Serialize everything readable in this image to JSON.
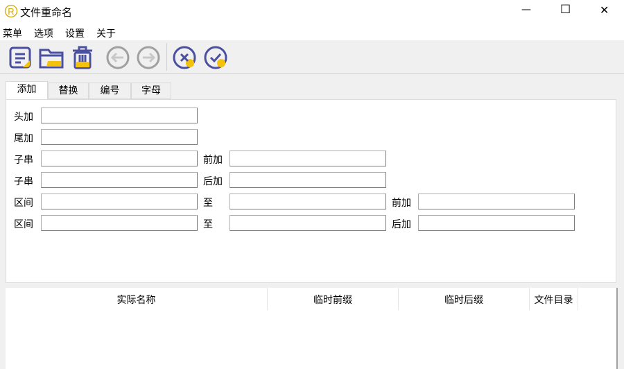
{
  "window": {
    "title": "文件重命名",
    "minimize": "—",
    "maximize": "☐",
    "close": "✕"
  },
  "menu": [
    "菜单",
    "选项",
    "设置",
    "关于"
  ],
  "toolbar": [
    "new-list",
    "open-folder",
    "delete",
    "undo",
    "redo",
    "cancel",
    "confirm"
  ],
  "colors": {
    "icon": "#4a4fa0",
    "accent": "#f4c20d",
    "disabled": "#a0a0a0"
  },
  "tabs": [
    "添加",
    "替换",
    "编号",
    "字母"
  ],
  "form": {
    "head": "头加",
    "tail": "尾加",
    "substr": "子串",
    "before": "前加",
    "after": "后加",
    "range": "区间",
    "to": "至"
  },
  "table": {
    "headers": [
      "实际名称",
      "临时前缀",
      "临时后缀",
      "文件目录"
    ]
  }
}
